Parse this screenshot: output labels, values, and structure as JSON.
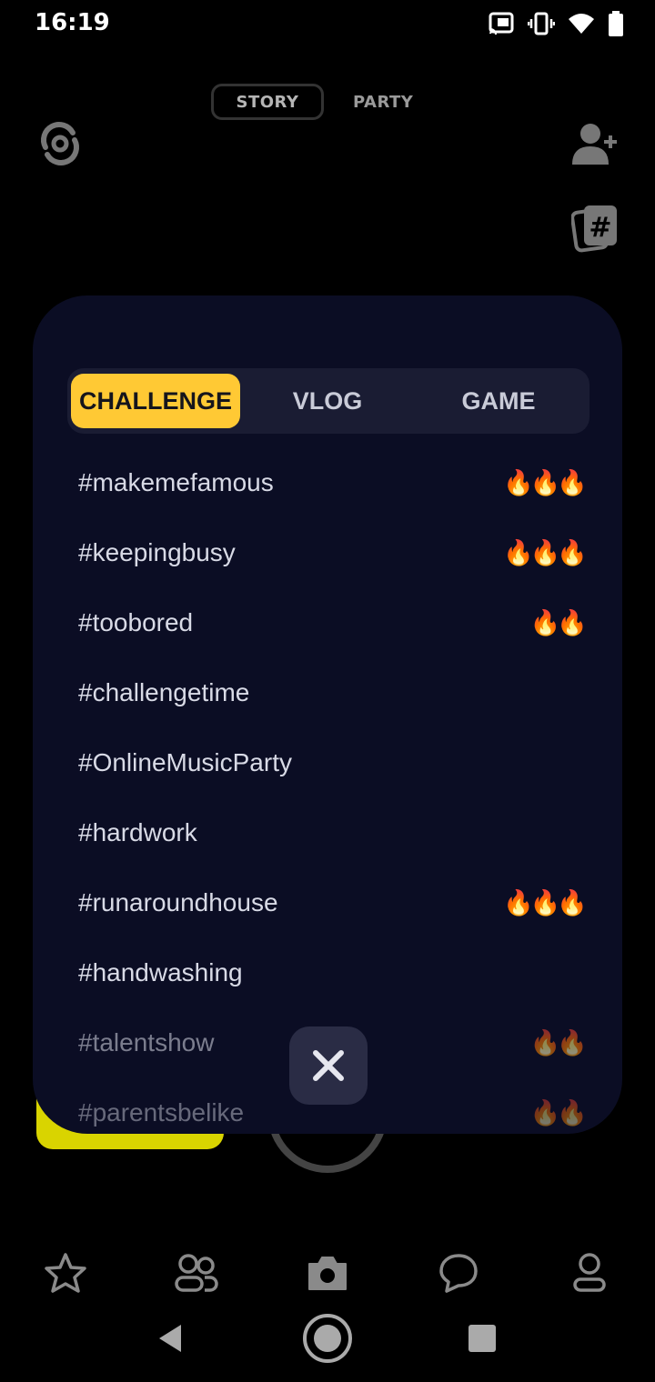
{
  "status_bar": {
    "time": "16:19"
  },
  "mode_switch": {
    "story": "STORY",
    "party": "PARTY"
  },
  "panel": {
    "tabs": [
      {
        "label": "CHALLENGE",
        "active": true
      },
      {
        "label": "VLOG",
        "active": false
      },
      {
        "label": "GAME",
        "active": false
      }
    ],
    "tags": [
      {
        "text": "#makemefamous",
        "fire": "🔥🔥🔥"
      },
      {
        "text": "#keepingbusy",
        "fire": "🔥🔥🔥"
      },
      {
        "text": "#toobored",
        "fire": "🔥🔥"
      },
      {
        "text": "#challengetime",
        "fire": ""
      },
      {
        "text": "#OnlineMusicParty",
        "fire": ""
      },
      {
        "text": "#hardwork",
        "fire": ""
      },
      {
        "text": "#runaroundhouse",
        "fire": "🔥🔥🔥"
      },
      {
        "text": "#handwashing",
        "fire": ""
      },
      {
        "text": "#talentshow",
        "fire": "🔥🔥"
      },
      {
        "text": "#parentsbelike",
        "fire": "🔥🔥"
      }
    ]
  },
  "colors": {
    "accent": "#ffc934",
    "panel_bg": "#0b0d24",
    "tab_bg": "#1a1c33"
  },
  "icons": [
    "flip-camera-icon",
    "add-friend-icon",
    "hashtag-cards-icon",
    "close-icon",
    "star-icon",
    "friends-icon",
    "camera-icon",
    "chat-icon",
    "profile-icon"
  ]
}
